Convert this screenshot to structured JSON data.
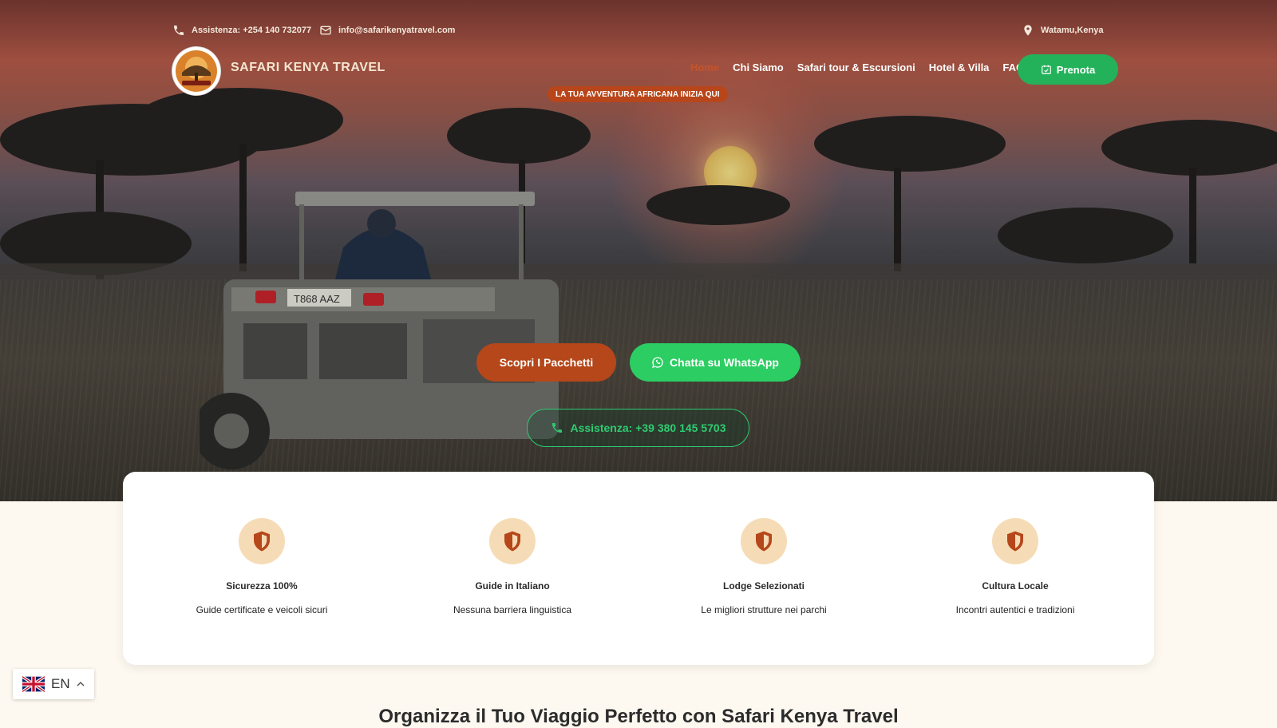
{
  "topbar": {
    "phone": "Assistenza: +254 140 732077",
    "email": "info@safarikenyatravel.com",
    "location": "Watamu,Kenya"
  },
  "brand": {
    "name": "SAFARI KENYA TRAVEL"
  },
  "nav": {
    "items": [
      {
        "label": "Home",
        "active": true
      },
      {
        "label": "Chi Siamo"
      },
      {
        "label": "Safari tour & Escursioni"
      },
      {
        "label": "Hotel & Villa"
      },
      {
        "label": "FAQ's"
      }
    ],
    "book_label": "Prenota"
  },
  "hero": {
    "tagline": "LA TUA AVVENTURA AFRICANA INIZIA QUI",
    "primary_button": "Scopri I Pacchetti",
    "whatsapp_button": "Chatta su WhatsApp",
    "phone_button": "Assistenza: +39 380 145 5703"
  },
  "features": [
    {
      "title": "Sicurezza 100%",
      "desc": "Guide certificate e veicoli sicuri"
    },
    {
      "title": "Guide in Italiano",
      "desc": "Nessuna barriera linguistica"
    },
    {
      "title": "Lodge Selezionati",
      "desc": "Le migliori strutture nei parchi"
    },
    {
      "title": "Cultura Locale",
      "desc": "Incontri autentici e tradizioni"
    }
  ],
  "section": {
    "title": "Organizza il Tuo Viaggio Perfetto con Safari Kenya Travel"
  },
  "language": {
    "code": "EN"
  },
  "colors": {
    "accent": "#b5471a",
    "whatsapp": "#2ccd62",
    "icon_bg": "#f6dcb6"
  }
}
